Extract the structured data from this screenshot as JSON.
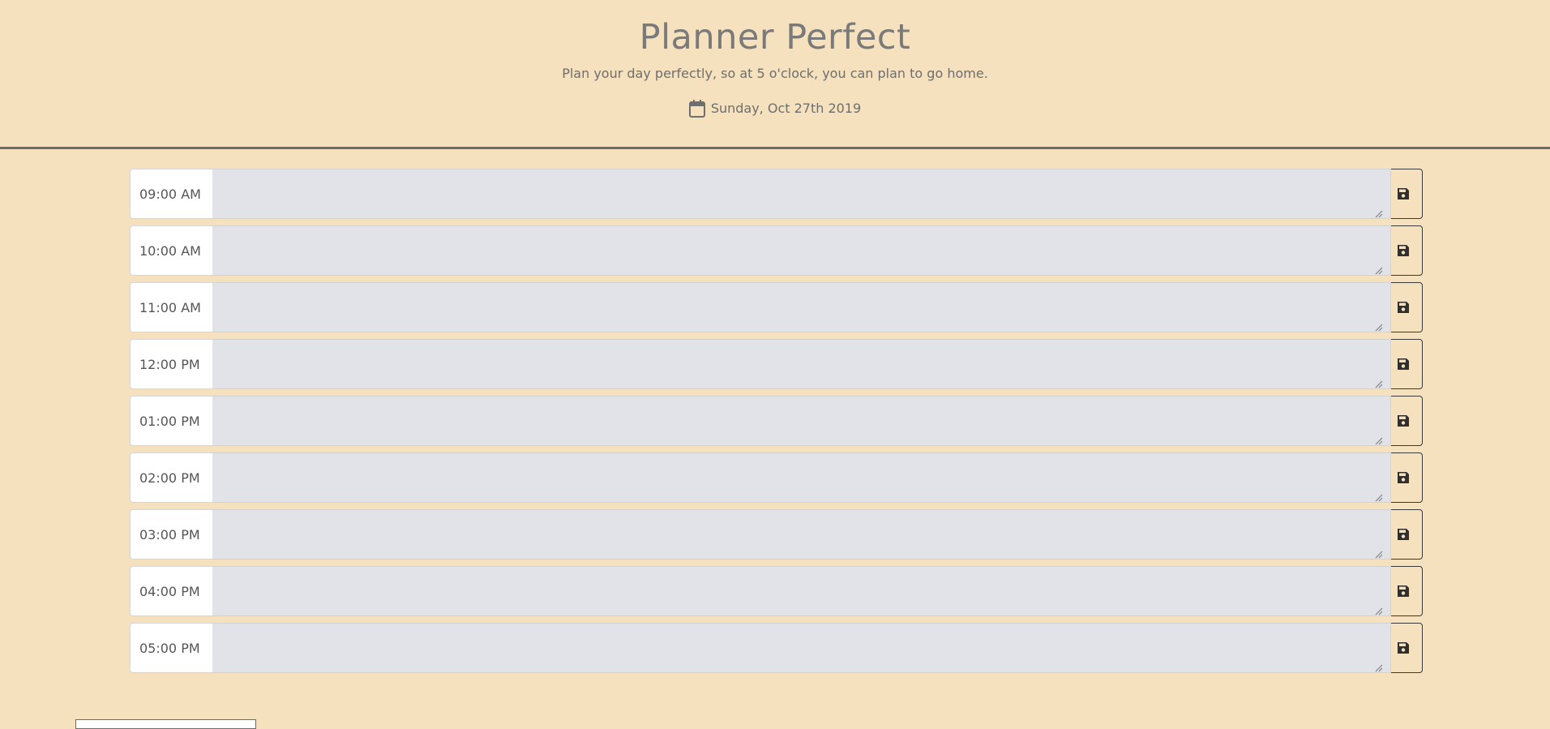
{
  "header": {
    "title": "Planner Perfect",
    "subtitle": "Plan your day perfectly, so at 5 o'clock, you can plan to go home.",
    "date": "Sunday, Oct 27th 2019",
    "date_icon": "calendar-icon"
  },
  "rows": [
    {
      "time": "09:00 AM",
      "note": "",
      "save_icon": "save-icon"
    },
    {
      "time": "10:00 AM",
      "note": "",
      "save_icon": "save-icon"
    },
    {
      "time": "11:00 AM",
      "note": "",
      "save_icon": "save-icon"
    },
    {
      "time": "12:00 PM",
      "note": "",
      "save_icon": "save-icon"
    },
    {
      "time": "01:00 PM",
      "note": "",
      "save_icon": "save-icon"
    },
    {
      "time": "02:00 PM",
      "note": "",
      "save_icon": "save-icon"
    },
    {
      "time": "03:00 PM",
      "note": "",
      "save_icon": "save-icon"
    },
    {
      "time": "04:00 PM",
      "note": "",
      "save_icon": "save-icon"
    },
    {
      "time": "05:00 PM",
      "note": "",
      "save_icon": "save-icon"
    }
  ],
  "colors": {
    "background": "#f5e1bd",
    "entry_background": "#e1e3e8",
    "divider": "#6b6b6b"
  }
}
